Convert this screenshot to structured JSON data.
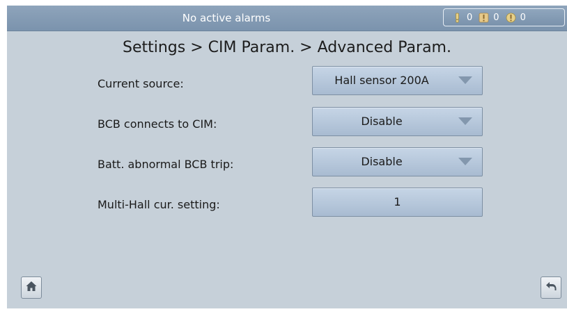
{
  "header": {
    "alarm_status": "No active alarms",
    "counts": {
      "major": "0",
      "minor": "0",
      "warning": "0"
    },
    "icons": [
      "major-alarm-icon",
      "minor-alarm-icon",
      "warning-alarm-icon"
    ]
  },
  "page": {
    "title": "Settings > CIM Param. > Advanced Param."
  },
  "rows": [
    {
      "label": "Current source:",
      "value": "Hall sensor 200A",
      "type": "dropdown"
    },
    {
      "label": "BCB connects to CIM:",
      "value": "Disable",
      "type": "dropdown"
    },
    {
      "label": "Batt. abnormal BCB trip:",
      "value": "Disable",
      "type": "dropdown"
    },
    {
      "label": "Multi-Hall cur. setting:",
      "value": "1",
      "type": "input"
    }
  ],
  "footer": {
    "home_icon": "home-icon",
    "back_icon": "back-icon"
  },
  "colors": {
    "background": "#c6d0d9",
    "header": "#7f97b0",
    "field": "#b4c5d9",
    "arrow": "#8397ad"
  }
}
